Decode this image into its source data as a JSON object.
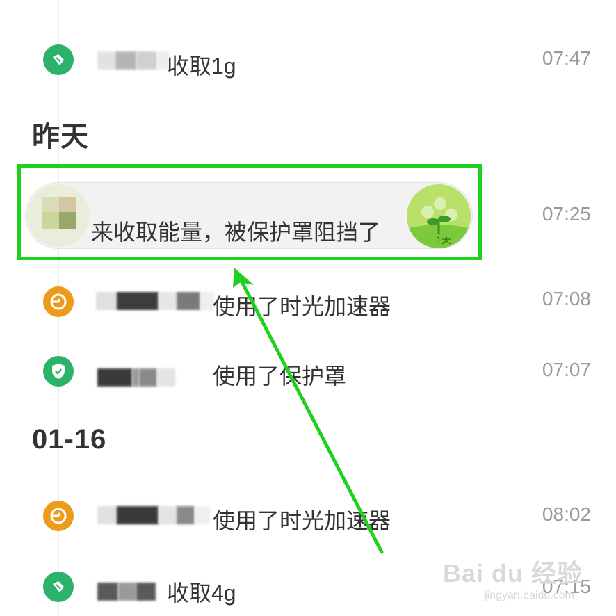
{
  "sections": [
    {
      "title": "昨天"
    },
    {
      "title": "01-16"
    }
  ],
  "rows": [
    {
      "action": "收取1g",
      "time": "07:47",
      "icon": "energy-collect-icon",
      "icon_color": "#2db26a"
    },
    {
      "action": "使用了时光加速器",
      "time": "07:08",
      "icon": "time-accelerator-icon",
      "icon_color": "#ec9b1b"
    },
    {
      "action": "使用了保护罩",
      "time": "07:07",
      "icon": "shield-icon",
      "icon_color": "#2db26a"
    },
    {
      "action": "使用了时光加速器",
      "time": "08:02",
      "icon": "time-accelerator-icon",
      "icon_color": "#ec9b1b"
    },
    {
      "action": "收取4g",
      "time": "07:15",
      "icon": "energy-collect-icon",
      "icon_color": "#2db26a"
    }
  ],
  "card": {
    "text": "来收取能量，被保护罩阻挡了",
    "time": "07:25",
    "badge_label": "1天",
    "highlight_color": "#1fd01f"
  },
  "watermark": {
    "text": "Bai du 经验",
    "url": "jingyan.baidu.com"
  },
  "annotation_arrow_color": "#1fd01f"
}
